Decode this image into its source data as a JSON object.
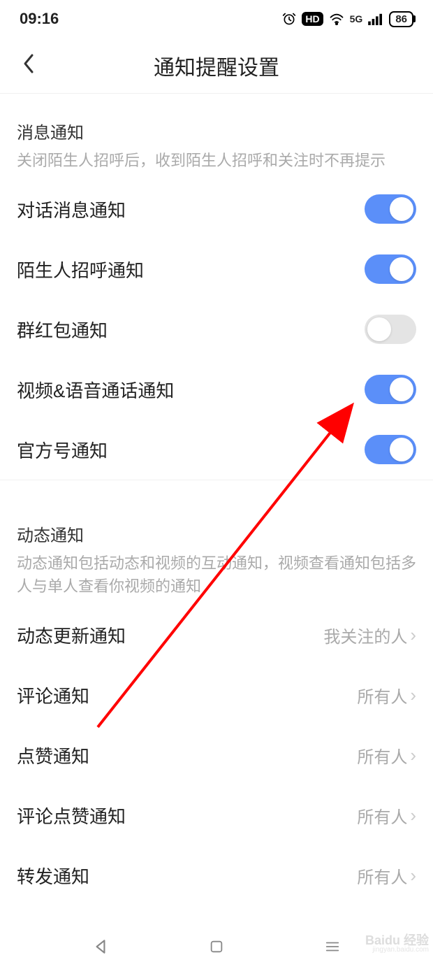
{
  "status": {
    "time": "09:16",
    "hd": "HD",
    "net": "5G",
    "battery": "86"
  },
  "header": {
    "title": "通知提醒设置"
  },
  "section1": {
    "title": "消息通知",
    "desc": "关闭陌生人招呼后，收到陌生人招呼和关注时不再提示",
    "rows": [
      {
        "label": "对话消息通知",
        "on": true
      },
      {
        "label": "陌生人招呼通知",
        "on": true
      },
      {
        "label": "群红包通知",
        "on": false
      },
      {
        "label": "视频&语音通话通知",
        "on": true
      },
      {
        "label": "官方号通知",
        "on": true
      }
    ]
  },
  "section2": {
    "title": "动态通知",
    "desc": "动态通知包括动态和视频的互动通知，视频查看通知包括多人与单人查看你视频的通知",
    "rows": [
      {
        "label": "动态更新通知",
        "value": "我关注的人"
      },
      {
        "label": "评论通知",
        "value": "所有人"
      },
      {
        "label": "点赞通知",
        "value": "所有人"
      },
      {
        "label": "评论点赞通知",
        "value": "所有人"
      },
      {
        "label": "转发通知",
        "value": "所有人"
      }
    ]
  },
  "watermark": {
    "brand": "Baidu 经验",
    "url": "jingyan.baidu.com"
  }
}
